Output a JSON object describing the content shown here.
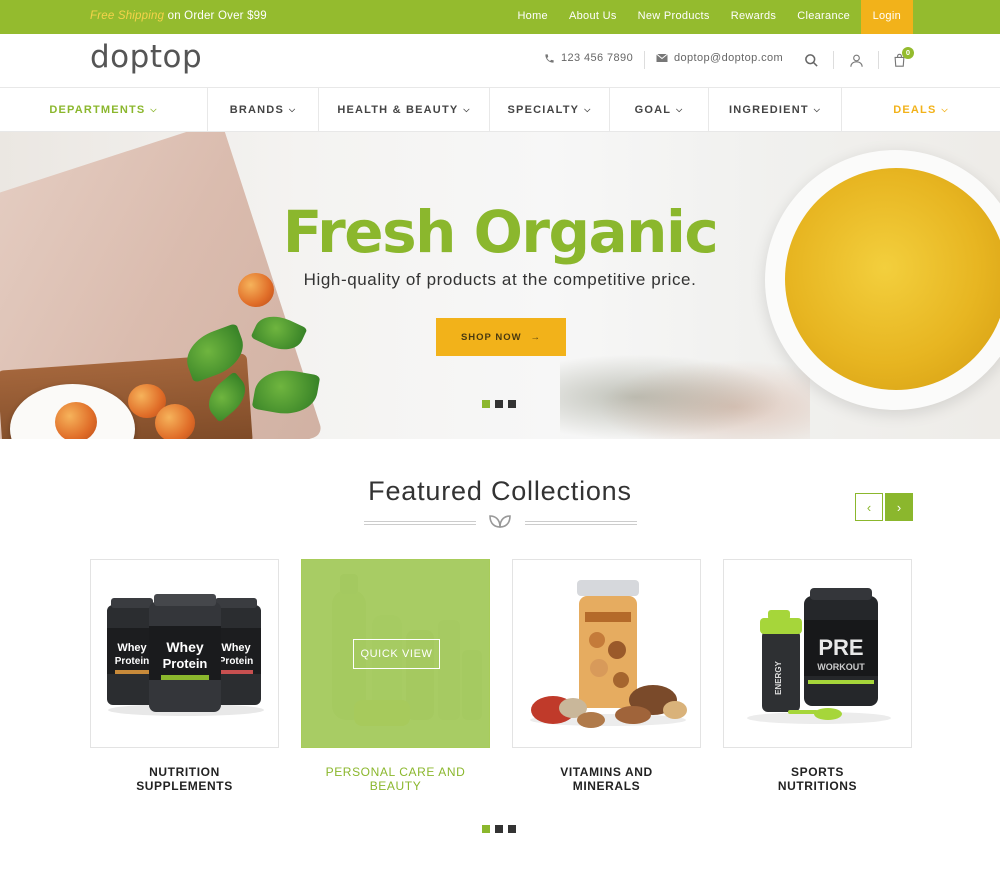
{
  "topbar": {
    "promo_highlight": "Free Shipping",
    "promo_rest": " on Order Over $99",
    "links": [
      "Home",
      "About Us",
      "New Products",
      "Rewards",
      "Clearance"
    ],
    "login": "Login"
  },
  "header": {
    "logo": "doptop",
    "phone": "123 456 7890",
    "email": "doptop@doptop.com",
    "cart_count": "0"
  },
  "nav": {
    "items": [
      {
        "label": "DEPARTMENTS",
        "style": "green"
      },
      {
        "label": "BRANDS",
        "style": "normal"
      },
      {
        "label": "HEALTH & BEAUTY",
        "style": "normal"
      },
      {
        "label": "SPECIALTY",
        "style": "normal"
      },
      {
        "label": "GOAL",
        "style": "normal"
      },
      {
        "label": "INGREDIENT",
        "style": "normal"
      },
      {
        "label": "DEALS",
        "style": "orange"
      }
    ]
  },
  "hero": {
    "title": "Fresh Organic",
    "subtitle": "High-quality of products at the competitive price.",
    "button": "SHOP NOW",
    "button_arrow": "→",
    "slide_count": 3,
    "active_slide": 1
  },
  "featured": {
    "title": "Featured Collections",
    "prev_icon": "‹",
    "next_icon": "›",
    "quick_view": "QUICK VIEW",
    "collections": [
      {
        "line1": "NUTRITION",
        "line2": "SUPPLEMENTS",
        "image": "whey-protein-tubs"
      },
      {
        "line1": "PERSONAL CARE AND",
        "line2": "BEAUTY",
        "image": "personal-care-bottles"
      },
      {
        "line1": "VITAMINS AND",
        "line2": "MINERALS",
        "image": "vitamin-jar-nuts"
      },
      {
        "line1": "SPORTS",
        "line2": "NUTRITIONS",
        "image": "pre-workout-shaker"
      }
    ],
    "page_count": 3,
    "active_page": 1
  },
  "colors": {
    "brand_green": "#8bb72d",
    "topbar_green": "#94bb2e",
    "accent_orange": "#f2b21a"
  }
}
